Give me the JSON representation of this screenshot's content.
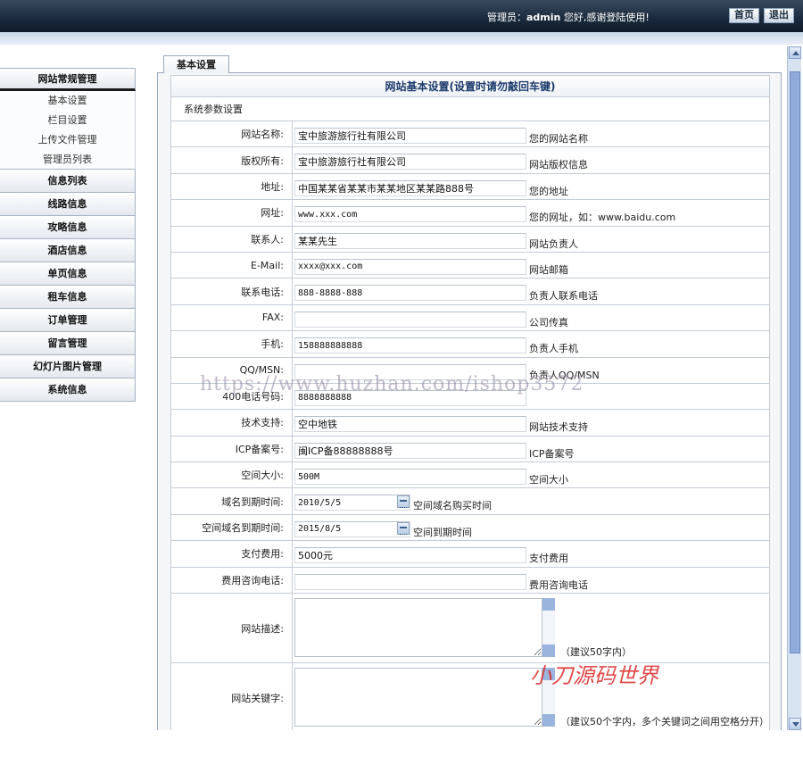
{
  "topbar": {
    "greeting_prefix": "管理员：",
    "username": "admin",
    "greeting_suffix": " 您好,感谢登陆使用!",
    "home_label": "首页",
    "logout_label": "退出"
  },
  "sidebar": {
    "section_title": "网站常规管理",
    "subitems": [
      "基本设置",
      "栏目设置",
      "上传文件管理",
      "管理员列表"
    ],
    "items": [
      "信息列表",
      "线路信息",
      "攻略信息",
      "酒店信息",
      "单页信息",
      "租车信息",
      "订单管理",
      "留言管理",
      "幻灯片图片管理",
      "系统信息"
    ]
  },
  "main": {
    "tab_label": "基本设置",
    "form_title": "网站基本设置(设置时请勿敲回车键)",
    "section_label": "系统参数设置",
    "fields": [
      {
        "label": "网站名称:",
        "value": "宝中旅游旅行社有限公司",
        "hint": "您的网站名称"
      },
      {
        "label": "版权所有:",
        "value": "宝中旅游旅行社有限公司",
        "hint": "网站版权信息"
      },
      {
        "label": "地址:",
        "value": "中国某某省某某市某某地区某某路888号",
        "hint": "您的地址"
      },
      {
        "label": "网址:",
        "value": "www.xxx.com",
        "hint": "您的网址，如：www.baidu.com"
      },
      {
        "label": "联系人:",
        "value": "某某先生",
        "hint": "网站负责人"
      },
      {
        "label": "E-Mail:",
        "value": "xxxx@xxx.com",
        "hint": "网站邮箱"
      },
      {
        "label": "联系电话:",
        "value": "888-8888-888",
        "hint": "负责人联系电话"
      },
      {
        "label": "FAX:",
        "value": "",
        "hint": "公司传真"
      },
      {
        "label": "手机:",
        "value": "158888888888",
        "hint": "负责人手机"
      },
      {
        "label": "QQ/MSN:",
        "value": "",
        "hint": "负责人QQ/MSN"
      },
      {
        "label": "400电话号码:",
        "value": "8888888888",
        "hint": ""
      },
      {
        "label": "技术支持:",
        "value": "空中地铁",
        "hint": "网站技术支持"
      },
      {
        "label": "ICP备案号:",
        "value": "闽ICP备88888888号",
        "hint": "ICP备案号"
      },
      {
        "label": "空间大小:",
        "value": "500M",
        "hint": "空间大小"
      }
    ],
    "date_fields": [
      {
        "label": "域名到期时间:",
        "value": "2010/5/5",
        "hint": "空间域名购买时间"
      },
      {
        "label": "空间域名到期时间:",
        "value": "2015/8/5",
        "hint": "空间到期时间"
      }
    ],
    "fee_fields": [
      {
        "label": "支付费用:",
        "value": "5000元",
        "hint": "支付费用"
      },
      {
        "label": "费用咨询电话:",
        "value": "",
        "hint": "费用咨询电话"
      }
    ],
    "textareas": [
      {
        "label": "网站描述:",
        "hint": "（建议50字内）"
      },
      {
        "label": "网站关键字:",
        "hint": "（建议50个字内，多个关键词之间用空格分开）"
      }
    ]
  },
  "watermarks": {
    "url": "https://www.huzhan.com/ishop3572",
    "brand": "小刀源码世界"
  }
}
